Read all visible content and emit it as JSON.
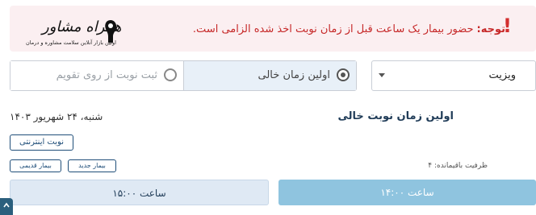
{
  "notice": {
    "label": "توجه:",
    "message": "حضور بیمار یک ساعت قبل از زمان نوبت اخذ شده الزامی است.",
    "icon": "exclamation-icon",
    "accent_color": "#c62828"
  },
  "logo": {
    "name": "همراه مشاور",
    "tagline": "اولین بازار آنلاین سلامت مشاوره و درمان"
  },
  "visit_select": {
    "value": "ویزیت",
    "icon": "chevron-down-icon"
  },
  "booking_mode": {
    "options": [
      {
        "label": "اولین زمان خالی",
        "selected": true
      },
      {
        "label": "ثبت نوبت از روی تقویم",
        "selected": false
      }
    ]
  },
  "section": {
    "title": "اولین زمان نوبت خالی"
  },
  "date": "شنبه، ۲۴ شهریور ۱۴۰۳",
  "chips": {
    "online": "نوبت اینترنتی",
    "new_patient": "بیمار جدید",
    "old_patient": "بیمار قدیمی"
  },
  "capacity": "ظرفیت باقیمانده: ۴",
  "slots": [
    {
      "label": "ساعت ۱۴:۰۰"
    },
    {
      "label": "ساعت ۱۵:۰۰"
    }
  ],
  "colors": {
    "primary_slot": "#8fc4df",
    "secondary_slot": "#dfe9f4",
    "notice_bg": "#fbeff1",
    "brand_dark": "#1f4e79"
  }
}
